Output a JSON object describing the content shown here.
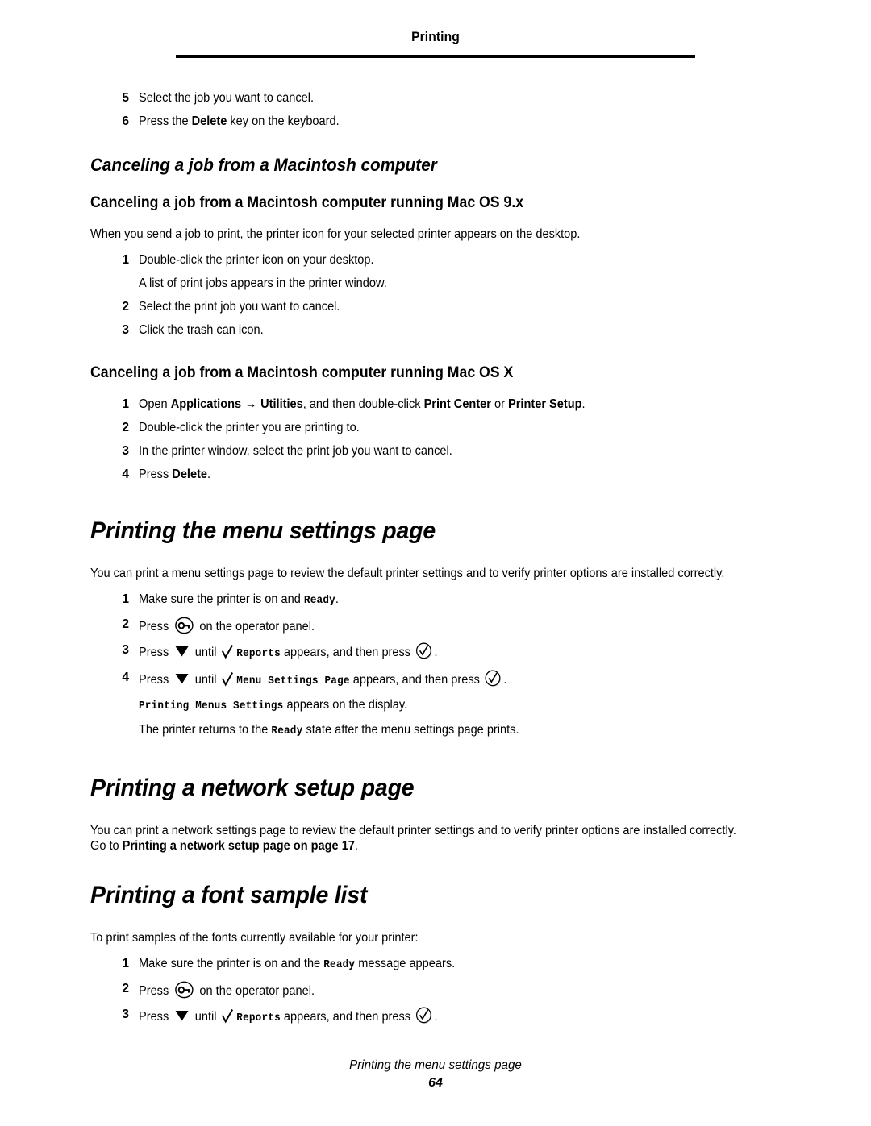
{
  "header": {
    "title": "Printing"
  },
  "continued_steps": [
    {
      "num": "5",
      "text": "Select the job you want to cancel."
    },
    {
      "num": "6",
      "text_before": "Press the ",
      "bold": "Delete",
      "text_after": " key on the keyboard."
    }
  ],
  "section_mac": {
    "heading": "Canceling a job from a Macintosh computer",
    "os9": {
      "heading": "Canceling a job from a Macintosh computer running Mac OS 9.x",
      "intro": "When you send a job to print, the printer icon for your selected printer appears on the desktop.",
      "steps": [
        {
          "num": "1",
          "text": "Double-click the printer icon on your desktop."
        },
        {
          "num": "2",
          "text": "Select the print job you want to cancel."
        },
        {
          "num": "3",
          "text": "Click the trash can icon."
        }
      ],
      "substep_after_1": "A list of print jobs appears in the printer window."
    },
    "osx": {
      "heading": "Canceling a job from a Macintosh computer running Mac OS X",
      "step1": {
        "num": "1",
        "t1": "Open ",
        "b1": "Applications",
        "arrow": "→",
        "b2": "Utilities",
        "t2": ", and then double-click ",
        "b3": "Print Center",
        "t3": " or ",
        "b4": "Printer Setup",
        "t4": "."
      },
      "steps": [
        {
          "num": "2",
          "text": "Double-click the printer you are printing to."
        },
        {
          "num": "3",
          "text": "In the printer window, select the print job you want to cancel."
        }
      ],
      "step4": {
        "num": "4",
        "t1": "Press ",
        "b1": "Delete",
        "t2": "."
      }
    }
  },
  "section_menu_settings": {
    "heading": "Printing the menu settings page",
    "intro": "You can print a menu settings page to review the default printer settings and to verify printer options are installed correctly.",
    "step1": {
      "num": "1",
      "t1": "Make sure the printer is on and ",
      "mono1": "Ready",
      "t2": "."
    },
    "step2": {
      "num": "2",
      "t1": "Press ",
      "icon": "menu-key-icon",
      "t2": " on the operator panel."
    },
    "step3": {
      "num": "3",
      "t1": "Press ",
      "icon_down": "down-arrow-icon",
      "t2": " until ",
      "icon_check": "checkmark-icon",
      "mono1": "Reports",
      "t3": " appears, and then press ",
      "icon_select": "select-check-circle-icon",
      "t4": "."
    },
    "step4": {
      "num": "4",
      "t1": "Press ",
      "icon_down": "down-arrow-icon",
      "t2": " until ",
      "icon_check": "checkmark-icon",
      "mono1": "Menu Settings Page",
      "t3": " appears, and then press ",
      "icon_select": "select-check-circle-icon",
      "t4": "."
    },
    "note1": {
      "mono1": "Printing Menus Settings",
      "t1": " appears on the display."
    },
    "note2": {
      "t1": "The printer returns to the ",
      "mono1": "Ready",
      "t2": " state after the menu settings page prints."
    }
  },
  "section_network": {
    "heading": "Printing a network setup page",
    "intro_t1": "You can print a network settings page to review the default printer settings and to verify printer options are installed correctly. Go to ",
    "intro_bold": "Printing a network setup page on page 17",
    "intro_t2": "."
  },
  "section_font_sample": {
    "heading": "Printing a font sample list",
    "intro": "To print samples of the fonts currently available for your printer:",
    "step1": {
      "num": "1",
      "t1": "Make sure the printer is on and the ",
      "mono1": "Ready",
      "t2": " message appears."
    },
    "step2": {
      "num": "2",
      "t1": "Press ",
      "icon": "menu-key-icon",
      "t2": " on the operator panel."
    },
    "step3": {
      "num": "3",
      "t1": "Press ",
      "icon_down": "down-arrow-icon",
      "t2": " until ",
      "icon_check": "checkmark-icon",
      "mono1": "Reports",
      "t3": " appears, and then press ",
      "icon_select": "select-check-circle-icon",
      "t4": "."
    }
  },
  "footer": {
    "title": "Printing the menu settings page",
    "page_number": "64"
  }
}
